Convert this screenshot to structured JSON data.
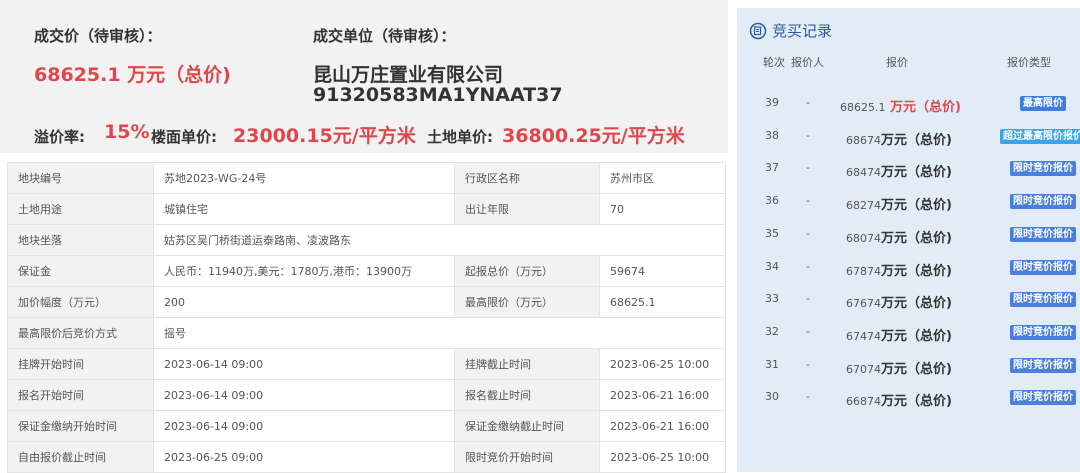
{
  "summary": {
    "deal_price_label": "成交价（待审核）：",
    "deal_price_value": "68625.1 万元（总价)",
    "deal_unit_label": "成交单位（待审核）：",
    "deal_unit_name": "昆山万庄置业有限公司",
    "deal_unit_code": "91320583MA1YNAAT37",
    "premium_label": "溢价率:",
    "premium_value": "15%",
    "floor_price_label": "楼面单价:",
    "floor_price_value": "23000.15元/平方米",
    "land_price_label": "土地单价:",
    "land_price_value": "36800.25元/平方米"
  },
  "info_rows": [
    {
      "k1": "地块编号",
      "v1": "苏地2023-WG-24号",
      "k2": "行政区名称",
      "v2": "苏州市区"
    },
    {
      "k1": "土地用途",
      "v1": "城镇住宅",
      "k2": "出让年限",
      "v2": "70"
    },
    {
      "k1": "地块坐落",
      "v1": "姑苏区吴门桥街道运泰路南、凌波路东"
    },
    {
      "k1": "保证金",
      "v1": "人民币：11940万,美元：1780万,港币：13900万",
      "k2": "起报总价（万元）",
      "v2": "59674"
    },
    {
      "k1": "加价幅度（万元）",
      "v1": "200",
      "k2": "最高限价（万元）",
      "v2": "68625.1"
    },
    {
      "k1": "最高限价后竞价方式",
      "v1": "摇号"
    },
    {
      "k1": "挂牌开始时间",
      "v1": "2023-06-14 09:00",
      "k2": "挂牌截止时间",
      "v2": "2023-06-25 10:00"
    },
    {
      "k1": "报名开始时间",
      "v1": "2023-06-14 09:00",
      "k2": "报名截止时间",
      "v2": "2023-06-21 16:00"
    },
    {
      "k1": "保证金缴纳开始时间",
      "v1": "2023-06-14 09:00",
      "k2": "保证金缴纳截止时间",
      "v2": "2023-06-21 16:00"
    },
    {
      "k1": "自由报价截止时间",
      "v1": "2023-06-25 09:00",
      "k2": "限时竞价开始时间",
      "v2": "2023-06-25 10:00"
    }
  ],
  "bidding": {
    "title": "竞买记录",
    "icon": "document-clock-icon",
    "headers": {
      "round": "轮次",
      "bidder": "报价人",
      "price": "报价",
      "type": "报价类型"
    },
    "rows": [
      {
        "round": "39",
        "bidder": "-",
        "amount": "68625.1",
        "unit": " 万元（总价)",
        "type": "最高限价",
        "tag_color": "#3f7ee0",
        "highlight": true
      },
      {
        "round": "38",
        "bidder": "-",
        "amount": "68674",
        "unit": "万元（总价)",
        "type": "超过最高限价报价",
        "tag_color": "#3aa3ea",
        "highlight": false
      },
      {
        "round": "37",
        "bidder": "-",
        "amount": "68474",
        "unit": "万元（总价)",
        "type": "限时竞价报价",
        "tag_color": "#4a7fe0",
        "highlight": false
      },
      {
        "round": "36",
        "bidder": "-",
        "amount": "68274",
        "unit": "万元（总价)",
        "type": "限时竞价报价",
        "tag_color": "#4a7fe0",
        "highlight": false
      },
      {
        "round": "35",
        "bidder": "-",
        "amount": "68074",
        "unit": "万元（总价)",
        "type": "限时竞价报价",
        "tag_color": "#4a7fe0",
        "highlight": false
      },
      {
        "round": "34",
        "bidder": "-",
        "amount": "67874",
        "unit": "万元（总价)",
        "type": "限时竞价报价",
        "tag_color": "#4a7fe0",
        "highlight": false
      },
      {
        "round": "33",
        "bidder": "-",
        "amount": "67674",
        "unit": "万元（总价)",
        "type": "限时竞价报价",
        "tag_color": "#4a7fe0",
        "highlight": false
      },
      {
        "round": "32",
        "bidder": "-",
        "amount": "67474",
        "unit": "万元（总价)",
        "type": "限时竞价报价",
        "tag_color": "#4a7fe0",
        "highlight": false
      },
      {
        "round": "31",
        "bidder": "-",
        "amount": "67074",
        "unit": "万元（总价)",
        "type": "限时竞价报价",
        "tag_color": "#4a7fe0",
        "highlight": false
      },
      {
        "round": "30",
        "bidder": "-",
        "amount": "66874",
        "unit": "万元（总价)",
        "type": "限时竞价报价",
        "tag_color": "#4a7fe0",
        "highlight": false
      }
    ]
  },
  "colors": {
    "accent_red": "#e0474c",
    "panel_bg": "#e2ecf7",
    "title_blue": "#2d5a9f"
  }
}
